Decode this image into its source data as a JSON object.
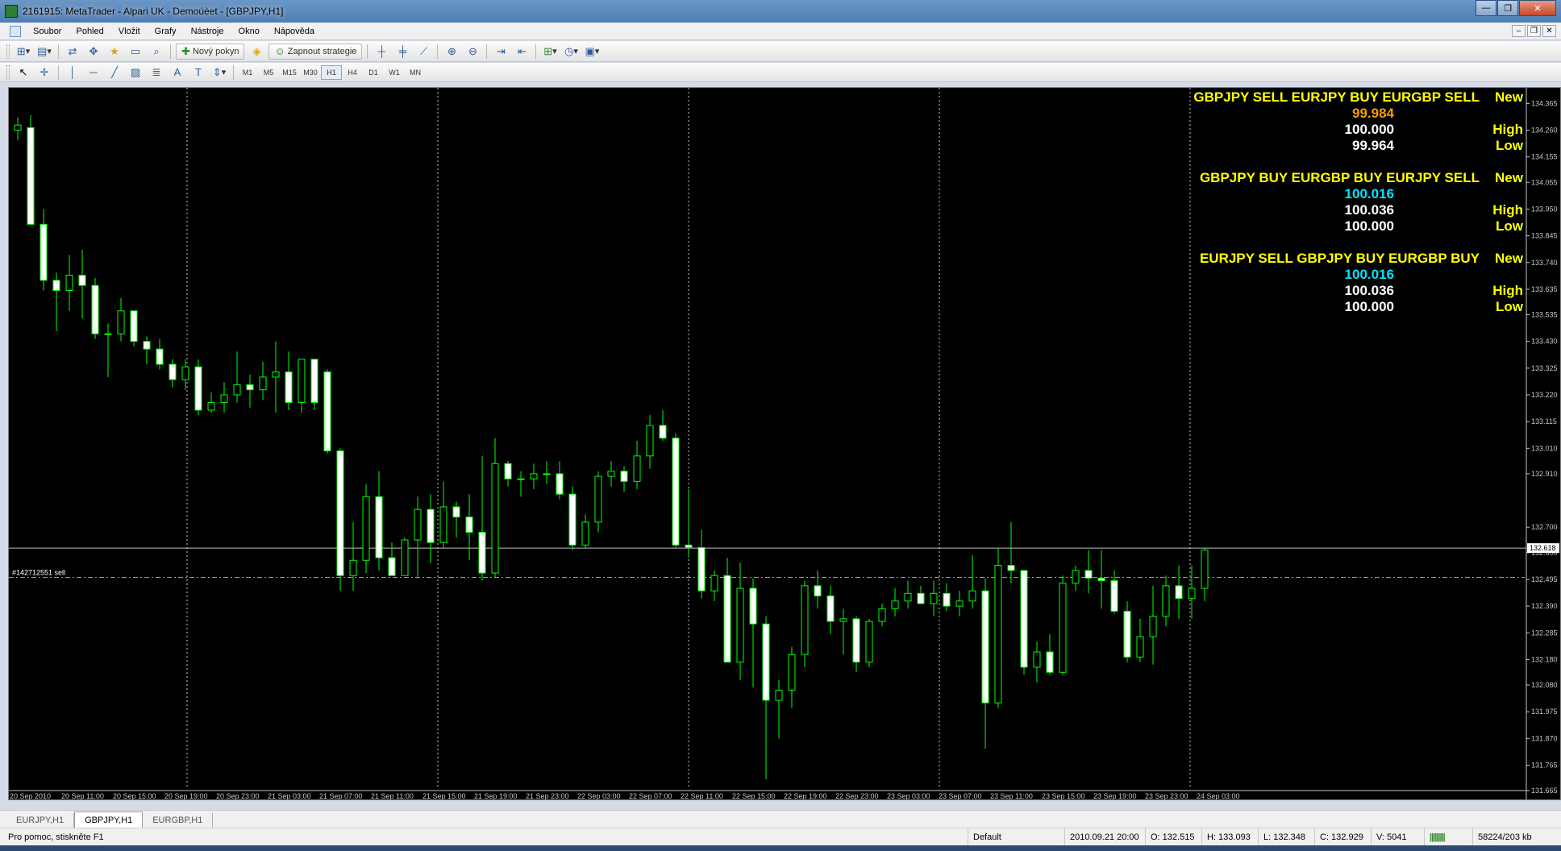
{
  "window": {
    "title": "2161915: MetaTrader - Alpari UK - Demoúèet - [GBPJPY,H1]",
    "controls": [
      "—",
      "❐",
      "✕"
    ]
  },
  "menu": [
    "Soubor",
    "Pohled",
    "Vložit",
    "Grafy",
    "Nástroje",
    "Okno",
    "Nápověda"
  ],
  "toolbar": {
    "new_order_label": "Nový pokyn",
    "strategy_label": "Zapnout strategie"
  },
  "timeframes": [
    "M1",
    "M5",
    "M15",
    "M30",
    "H1",
    "H4",
    "D1",
    "W1",
    "MN"
  ],
  "active_timeframe": "H1",
  "chart": {
    "symbol": "GBPJPY",
    "bg_color": "#000000",
    "bull_color": "#ffffff",
    "bear_color": "#ffffff",
    "wick_color": "#00ff00",
    "order_label": "#142712551 sell",
    "order_price": 132.503,
    "bid_price": 132.618,
    "bid_label": "132.618",
    "y_ticks": [
      "134.365",
      "134.260",
      "134.155",
      "134.055",
      "133.950",
      "133.845",
      "133.740",
      "133.635",
      "133.535",
      "133.430",
      "133.325",
      "133.220",
      "133.115",
      "133.010",
      "132.910",
      "132.700",
      "132.600",
      "132.495",
      "132.390",
      "132.285",
      "132.180",
      "132.080",
      "131.975",
      "131.870",
      "131.765",
      "131.665"
    ],
    "x_ticks": [
      "20 Sep 2010",
      "20 Sep 11:00",
      "20 Sep 15:00",
      "20 Sep 19:00",
      "20 Sep 23:00",
      "21 Sep 03:00",
      "21 Sep 07:00",
      "21 Sep 11:00",
      "21 Sep 15:00",
      "21 Sep 19:00",
      "21 Sep 23:00",
      "22 Sep 03:00",
      "22 Sep 07:00",
      "22 Sep 11:00",
      "22 Sep 15:00",
      "22 Sep 19:00",
      "22 Sep 23:00",
      "23 Sep 03:00",
      "23 Sep 07:00",
      "23 Sep 11:00",
      "23 Sep 15:00",
      "23 Sep 19:00",
      "23 Sep 23:00",
      "24 Sep 03:00"
    ],
    "ylim": [
      131.64,
      134.42
    ]
  },
  "panels": [
    {
      "pair": "GBPJPY SELL  EURJPY BUY  EURGBP SELL",
      "tag_new": "New",
      "current": "99.984",
      "current_color": "#ff9900",
      "high": "100.000",
      "high_label": "High",
      "low": "99.964",
      "low_label": "Low"
    },
    {
      "pair": "GBPJPY BUY  EURGBP BUY  EURJPY SELL",
      "tag_new": "New",
      "current": "100.016",
      "current_color": "#00e5ff",
      "high": "100.036",
      "high_label": "High",
      "low": "100.000",
      "low_label": "Low"
    },
    {
      "pair": "EURJPY SELL  GBPJPY BUY  EURGBP BUY",
      "tag_new": "New",
      "current": "100.016",
      "current_color": "#00e5ff",
      "high": "100.036",
      "high_label": "High",
      "low": "100.000",
      "low_label": "Low"
    }
  ],
  "tabs": [
    "EURJPY,H1",
    "GBPJPY,H1",
    "EURGBP,H1"
  ],
  "active_tab": 1,
  "status": {
    "help": "Pro pomoc, stiskněte F1",
    "profile": "Default",
    "datetime": "2010.09.21 20:00",
    "open": "O: 132.515",
    "high": "H: 133.093",
    "low": "L: 132.348",
    "close": "C: 132.929",
    "volume": "V: 5041",
    "traffic": "58224/203 kb"
  },
  "chart_data": {
    "type": "candlestick",
    "title": "",
    "x_tick_labels": [
      "20 Sep 2010",
      "20 Sep 11:00",
      "20 Sep 15:00",
      "20 Sep 19:00",
      "20 Sep 23:00",
      "21 Sep 03:00",
      "21 Sep 07:00",
      "21 Sep 11:00",
      "21 Sep 15:00",
      "21 Sep 19:00",
      "21 Sep 23:00",
      "22 Sep 03:00",
      "22 Sep 07:00",
      "22 Sep 11:00",
      "22 Sep 15:00",
      "22 Sep 19:00",
      "22 Sep 23:00",
      "23 Sep 03:00",
      "23 Sep 07:00",
      "23 Sep 11:00",
      "23 Sep 15:00",
      "23 Sep 19:00",
      "23 Sep 23:00",
      "24 Sep 03:00"
    ],
    "ylim": [
      131.64,
      134.42
    ],
    "ohlc": [
      [
        134.26,
        134.31,
        134.22,
        134.28
      ],
      [
        134.27,
        134.32,
        133.9,
        133.89
      ],
      [
        133.89,
        133.95,
        133.63,
        133.67
      ],
      [
        133.67,
        133.7,
        133.47,
        133.63
      ],
      [
        133.63,
        133.77,
        133.55,
        133.69
      ],
      [
        133.69,
        133.79,
        133.52,
        133.65
      ],
      [
        133.65,
        133.68,
        133.44,
        133.46
      ],
      [
        133.46,
        133.5,
        133.29,
        133.46
      ],
      [
        133.46,
        133.6,
        133.43,
        133.55
      ],
      [
        133.55,
        133.55,
        133.41,
        133.43
      ],
      [
        133.43,
        133.45,
        133.34,
        133.4
      ],
      [
        133.4,
        133.44,
        133.32,
        133.34
      ],
      [
        133.34,
        133.36,
        133.25,
        133.28
      ],
      [
        133.28,
        133.36,
        133.24,
        133.33
      ],
      [
        133.33,
        133.36,
        133.14,
        133.16
      ],
      [
        133.16,
        133.23,
        133.15,
        133.19
      ],
      [
        133.19,
        133.27,
        133.15,
        133.22
      ],
      [
        133.22,
        133.39,
        133.19,
        133.26
      ],
      [
        133.26,
        133.3,
        133.17,
        133.24
      ],
      [
        133.24,
        133.35,
        133.2,
        133.29
      ],
      [
        133.29,
        133.43,
        133.15,
        133.31
      ],
      [
        133.31,
        133.39,
        133.16,
        133.19
      ],
      [
        133.19,
        133.36,
        133.15,
        133.36
      ],
      [
        133.36,
        133.36,
        133.16,
        133.19
      ],
      [
        133.31,
        133.32,
        132.99,
        133.0
      ],
      [
        133.0,
        133.01,
        132.45,
        132.51
      ],
      [
        132.51,
        132.72,
        132.45,
        132.57
      ],
      [
        132.57,
        132.87,
        132.52,
        132.82
      ],
      [
        132.82,
        132.92,
        132.53,
        132.58
      ],
      [
        132.58,
        132.64,
        132.51,
        132.51
      ],
      [
        132.51,
        132.66,
        132.51,
        132.65
      ],
      [
        132.65,
        132.82,
        132.5,
        132.77
      ],
      [
        132.77,
        132.83,
        132.56,
        132.64
      ],
      [
        132.64,
        132.88,
        132.62,
        132.78
      ],
      [
        132.78,
        132.8,
        132.66,
        132.74
      ],
      [
        132.74,
        132.83,
        132.57,
        132.68
      ],
      [
        132.68,
        132.98,
        132.49,
        132.52
      ],
      [
        132.52,
        133.05,
        132.5,
        132.95
      ],
      [
        132.95,
        132.96,
        132.86,
        132.89
      ],
      [
        132.89,
        132.92,
        132.82,
        132.89
      ],
      [
        132.89,
        132.95,
        132.85,
        132.91
      ],
      [
        132.91,
        132.96,
        132.87,
        132.91
      ],
      [
        132.91,
        132.96,
        132.81,
        132.83
      ],
      [
        132.83,
        132.86,
        132.61,
        132.63
      ],
      [
        132.63,
        132.75,
        132.62,
        132.72
      ],
      [
        132.72,
        132.92,
        132.68,
        132.9
      ],
      [
        132.9,
        132.96,
        132.86,
        132.92
      ],
      [
        132.92,
        132.94,
        132.84,
        132.88
      ],
      [
        132.88,
        133.04,
        132.85,
        132.98
      ],
      [
        132.98,
        133.14,
        132.93,
        133.1
      ],
      [
        133.1,
        133.16,
        133.04,
        133.05
      ],
      [
        133.05,
        133.07,
        132.62,
        132.63
      ],
      [
        132.63,
        132.85,
        132.58,
        132.62
      ],
      [
        132.62,
        132.69,
        132.42,
        132.45
      ],
      [
        132.45,
        132.53,
        132.41,
        132.51
      ],
      [
        132.51,
        132.58,
        132.18,
        132.17
      ],
      [
        132.17,
        132.56,
        132.1,
        132.46
      ],
      [
        132.46,
        132.5,
        132.07,
        132.32
      ],
      [
        132.32,
        132.35,
        131.71,
        132.02
      ],
      [
        132.02,
        132.1,
        131.87,
        132.06
      ],
      [
        132.06,
        132.23,
        131.99,
        132.2
      ],
      [
        132.2,
        132.49,
        132.15,
        132.47
      ],
      [
        132.47,
        132.53,
        132.38,
        132.43
      ],
      [
        132.43,
        132.47,
        132.28,
        132.33
      ],
      [
        132.33,
        132.38,
        132.2,
        132.34
      ],
      [
        132.34,
        132.35,
        132.13,
        132.17
      ],
      [
        132.17,
        132.34,
        132.15,
        132.33
      ],
      [
        132.33,
        132.4,
        132.31,
        132.38
      ],
      [
        132.38,
        132.46,
        132.35,
        132.41
      ],
      [
        132.41,
        132.49,
        132.38,
        132.44
      ],
      [
        132.44,
        132.47,
        132.4,
        132.4
      ],
      [
        132.4,
        132.49,
        132.35,
        132.44
      ],
      [
        132.44,
        132.48,
        132.37,
        132.39
      ],
      [
        132.39,
        132.45,
        132.35,
        132.41
      ],
      [
        132.41,
        132.59,
        132.38,
        132.45
      ],
      [
        132.45,
        132.5,
        131.83,
        132.01
      ],
      [
        132.01,
        132.62,
        131.99,
        132.55
      ],
      [
        132.55,
        132.72,
        132.48,
        132.53
      ],
      [
        132.53,
        132.53,
        132.12,
        132.15
      ],
      [
        132.15,
        132.25,
        132.09,
        132.21
      ],
      [
        132.21,
        132.28,
        132.12,
        132.13
      ],
      [
        132.13,
        132.51,
        132.12,
        132.48
      ],
      [
        132.48,
        132.55,
        132.45,
        132.53
      ],
      [
        132.53,
        132.61,
        132.44,
        132.5
      ],
      [
        132.5,
        132.61,
        132.38,
        132.49
      ],
      [
        132.49,
        132.53,
        132.36,
        132.37
      ],
      [
        132.37,
        132.41,
        132.17,
        132.19
      ],
      [
        132.19,
        132.34,
        132.17,
        132.27
      ],
      [
        132.27,
        132.47,
        132.16,
        132.35
      ],
      [
        132.35,
        132.51,
        132.31,
        132.47
      ],
      [
        132.47,
        132.55,
        132.34,
        132.42
      ],
      [
        132.42,
        132.55,
        132.34,
        132.46
      ],
      [
        132.46,
        132.62,
        132.41,
        132.61
      ]
    ]
  }
}
